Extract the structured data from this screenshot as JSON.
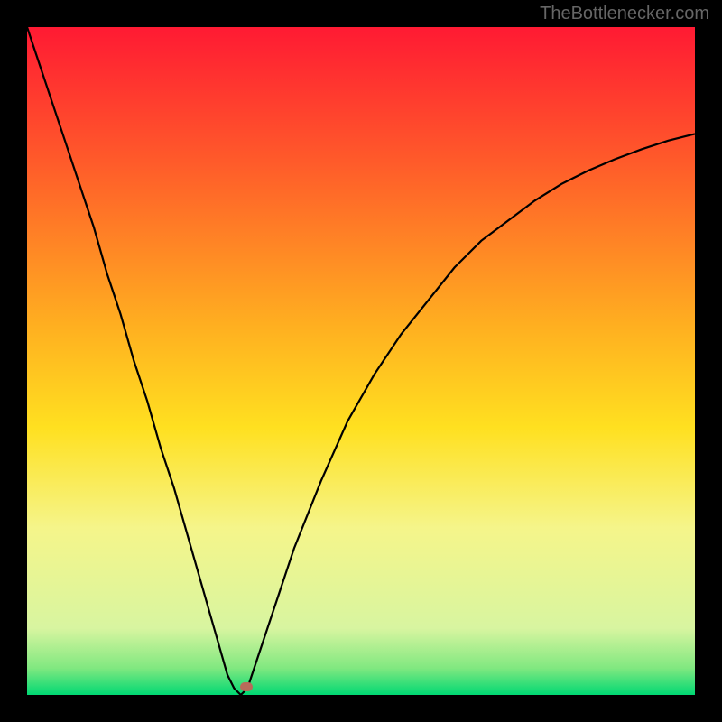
{
  "watermark": "TheBottlenecker.com",
  "chart_data": {
    "type": "line",
    "title": "",
    "xlabel": "",
    "ylabel": "",
    "xlim": [
      0,
      100
    ],
    "ylim": [
      0,
      100
    ],
    "x_min_at": 32,
    "gradient_stops": [
      {
        "pct": 0,
        "color": "#ff1a33"
      },
      {
        "pct": 20,
        "color": "#ff5a2a"
      },
      {
        "pct": 45,
        "color": "#ffb020"
      },
      {
        "pct": 60,
        "color": "#ffe020"
      },
      {
        "pct": 75,
        "color": "#f5f58a"
      },
      {
        "pct": 90,
        "color": "#d8f5a0"
      },
      {
        "pct": 96,
        "color": "#80e880"
      },
      {
        "pct": 100,
        "color": "#00d873"
      }
    ],
    "series": [
      {
        "name": "bottleneck-curve",
        "color": "#000000",
        "x": [
          0,
          2,
          4,
          6,
          8,
          10,
          12,
          14,
          16,
          18,
          20,
          22,
          24,
          26,
          28,
          30,
          31,
          32,
          33,
          34,
          36,
          38,
          40,
          44,
          48,
          52,
          56,
          60,
          64,
          68,
          72,
          76,
          80,
          84,
          88,
          92,
          96,
          100
        ],
        "y": [
          100,
          94,
          88,
          82,
          76,
          70,
          63,
          57,
          50,
          44,
          37,
          31,
          24,
          17,
          10,
          3,
          1,
          0,
          1,
          4,
          10,
          16,
          22,
          32,
          41,
          48,
          54,
          59,
          64,
          68,
          71,
          74,
          76.5,
          78.5,
          80.2,
          81.7,
          83,
          84
        ]
      }
    ],
    "marker": {
      "x": 32.8,
      "y": 1.2,
      "color": "#b86a5a"
    }
  }
}
